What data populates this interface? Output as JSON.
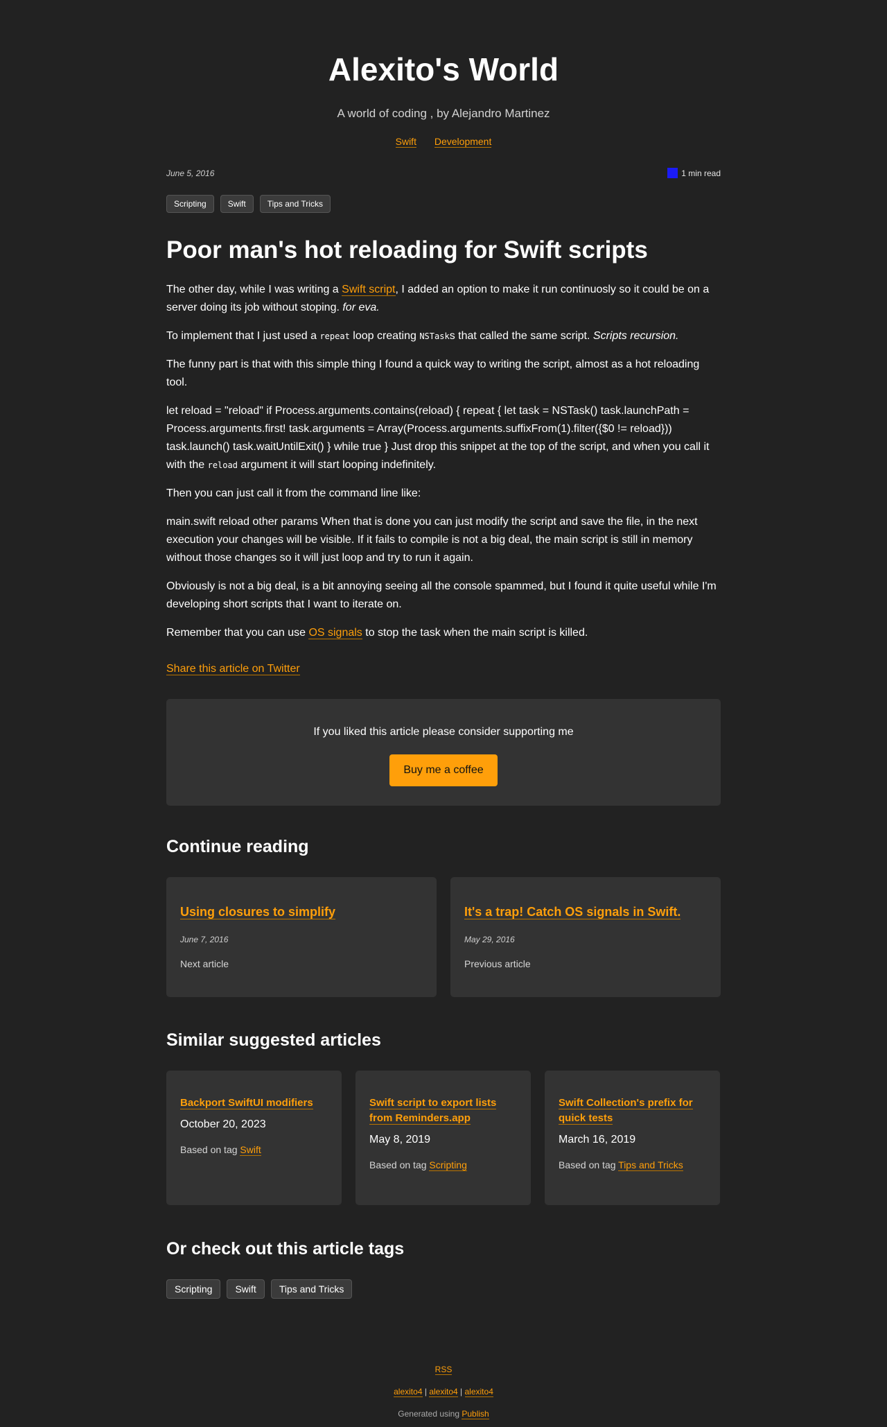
{
  "site": {
    "title": "Alexito's World",
    "subtitle": "A world of coding , by Alejandro Martinez",
    "nav": [
      "Swift",
      "Development"
    ]
  },
  "post": {
    "date": "June 5, 2016",
    "read_time": "1 min read",
    "read_icon_color": "#1b1bf5",
    "tags": [
      "Scripting",
      "Swift",
      "Tips and Tricks"
    ],
    "title": "Poor man's hot reloading for Swift scripts",
    "p1_a": "The other day, while I was writing a ",
    "p1_link": "Swift script",
    "p1_b": ", I added an option to make it run continuosly so it could be on a server doing its job without stoping. ",
    "p1_em": "for eva.",
    "p2_a": "To implement that I just used a ",
    "p2_code1": "repeat",
    "p2_b": " loop creating ",
    "p2_code2": "NSTask",
    "p2_c": "s that called the same script. ",
    "p2_em": "Scripts recursion.",
    "p3": "The funny part is that with this simple thing I found a quick way to writing the script, almost as a hot reloading tool.",
    "p4_a": "let reload = \"reload\" if Process.arguments.contains(reload) { repeat { let task = NSTask() task.launchPath = Process.arguments.first! task.arguments = Array(Process.arguments.suffixFrom(1).filter({$0 != reload})) task.launch() task.waitUntilExit() } while true } Just drop this snippet at the top of the script, and when you call it with the ",
    "p4_code": "reload",
    "p4_b": " argument it will start looping indefinitely.",
    "p5": "Then you can just call it from the command line like:",
    "p6": "main.swift reload other params When that is done you can just modify the script and save the file, in the next execution your changes will be visible. If it fails to compile is not a big deal, the main script is still in memory without those changes so it will just loop and try to run it again.",
    "p7": "Obviously is not a big deal, is a bit annoying seeing all the console spammed, but I found it quite useful while I'm developing short scripts that I want to iterate on.",
    "p8_a": "Remember that you can use ",
    "p8_link": "OS signals",
    "p8_b": " to stop the task when the main script is killed.",
    "share": "Share this article on Twitter"
  },
  "support": {
    "text": "If you liked this article please consider supporting me",
    "button": "Buy me a coffee",
    "button_color": "#ff9f0a"
  },
  "continue": {
    "title": "Continue reading",
    "items": [
      {
        "title": "Using closures to simplify",
        "date": "June 7, 2016",
        "label": "Next article"
      },
      {
        "title": "It's a trap! Catch OS signals in Swift.",
        "date": "May 29, 2016",
        "label": "Previous article"
      }
    ]
  },
  "similar": {
    "title": "Similar suggested articles",
    "based_prefix": "Based on tag ",
    "items": [
      {
        "title": "Backport SwiftUI modifiers",
        "date": "October 20, 2023",
        "tag": "Swift"
      },
      {
        "title": "Swift script to export lists from Reminders.app",
        "date": "May 8, 2019",
        "tag": "Scripting"
      },
      {
        "title": "Swift Collection's prefix for quick tests",
        "date": "March 16, 2019",
        "tag": "Tips and Tricks"
      }
    ]
  },
  "tags_section": {
    "title": "Or check out this article tags",
    "tags": [
      "Scripting",
      "Swift",
      "Tips and Tricks"
    ]
  },
  "footer": {
    "rss": "RSS",
    "links": [
      "alexito4",
      "alexito4",
      "alexito4"
    ],
    "separator": "|",
    "generated": "Generated using ",
    "publish": "Publish"
  },
  "colors": {
    "background": "#222222",
    "card": "#333333",
    "accent": "#ff9f0a"
  }
}
